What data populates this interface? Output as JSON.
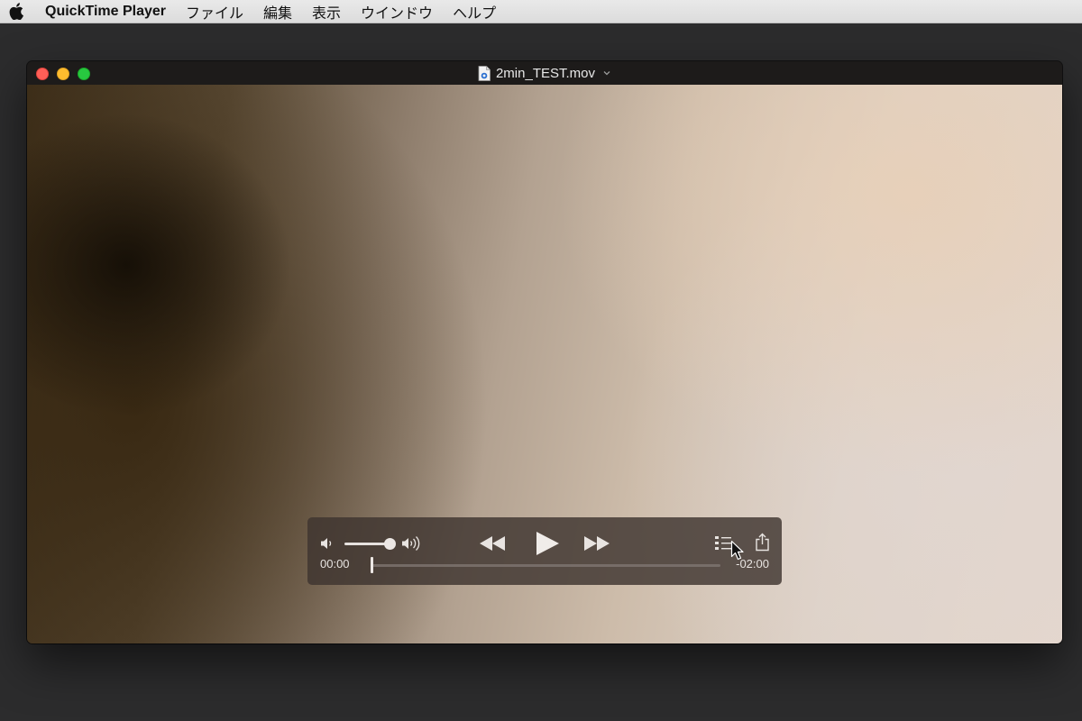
{
  "menubar": {
    "apple_icon": "apple-logo",
    "app_name": "QuickTime Player",
    "items": [
      "ファイル",
      "編集",
      "表示",
      "ウインドウ",
      "ヘルプ"
    ]
  },
  "window": {
    "title": "2min_TEST.mov",
    "title_icon": "quicktime-document-icon",
    "traffic_light_colors": {
      "close": "#fe5f57",
      "minimize": "#febc2e",
      "zoom": "#28c840"
    }
  },
  "controls": {
    "volume_level": 0.85,
    "elapsed": "00:00",
    "remaining": "-02:00",
    "playback_progress": 0.0,
    "icons": [
      "volume-low-icon",
      "volume-high-icon",
      "rewind-icon",
      "play-icon",
      "fast-forward-icon",
      "chapters-icon",
      "share-icon"
    ]
  }
}
